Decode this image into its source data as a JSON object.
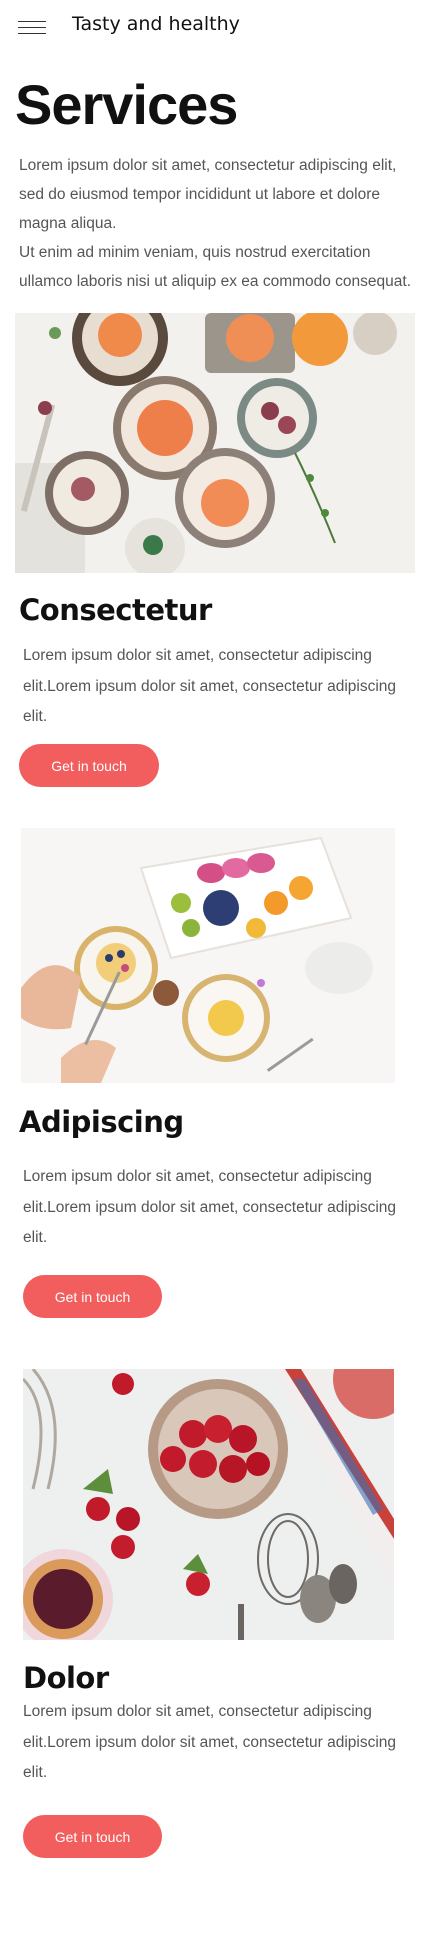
{
  "header": {
    "brand": "Tasty and healthy",
    "menu_icon": "hamburger-menu-icon"
  },
  "page": {
    "title": "Services",
    "intro_1": "Lorem ipsum dolor sit amet, consectetur adipiscing elit, sed do eiusmod tempor incididunt ut labore et dolore magna aliqua.",
    "intro_2": "Ut enim ad minim veniam, quis nostrud exercitation ullamco laboris nisi ut aliquip ex ea commodo consequat."
  },
  "services": [
    {
      "title": "Consectetur",
      "text": "Lorem ipsum dolor sit amet, consectetur adipiscing elit.Lorem ipsum dolor sit amet, consectetur adipiscing elit.",
      "button": "Get in touch"
    },
    {
      "title": "Adipiscing",
      "text": "Lorem ipsum dolor sit amet, consectetur adipiscing elit.Lorem ipsum dolor sit amet, consectetur adipiscing elit.",
      "button": "Get in touch"
    },
    {
      "title": "Dolor",
      "text": "Lorem ipsum dolor sit amet, consectetur adipiscing elit.Lorem ipsum dolor sit amet, consectetur adipiscing elit.",
      "button": "Get in touch"
    }
  ],
  "colors": {
    "accent": "#f25d5d",
    "text": "#555555",
    "heading": "#111111"
  }
}
